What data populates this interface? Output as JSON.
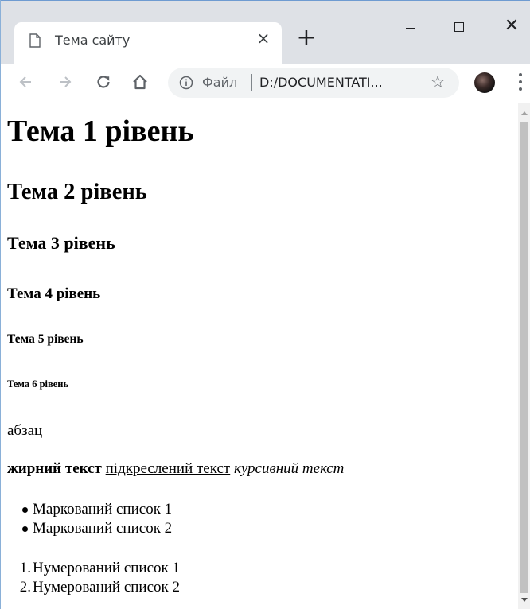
{
  "browser": {
    "tab_title": "Тема сайту",
    "tab_close": "×",
    "new_tab": "+",
    "window_close": "✕",
    "omnibox_label": "Файл",
    "omnibox_url": "D:/DOCUMENTATI...",
    "icons": {
      "tab": "page-icon",
      "back": "arrow-left-icon",
      "forward": "arrow-right-icon",
      "reload": "reload-icon",
      "home": "home-icon",
      "info": "info-icon",
      "star": "star-icon",
      "menu": "kebab-menu-icon"
    }
  },
  "page": {
    "h1": "Тема 1 рівень",
    "h2": "Тема 2 рівень",
    "h3": "Тема 3 рівень",
    "h4": "Тема 4 рівень",
    "h5": "Тема 5 рівень",
    "h6": "Тема 6 рівень",
    "paragraph": "абзац",
    "bold_text": "жирний текст",
    "underline_text": "підкреслений текст",
    "italic_text": "курсивний текст",
    "bullet_list": [
      "Маркований список 1",
      "Маркований список 2"
    ],
    "numbered_list": [
      "Нумерований список 1",
      "Нумерований список 2"
    ],
    "numbered_markers": [
      "1.",
      "2."
    ]
  }
}
